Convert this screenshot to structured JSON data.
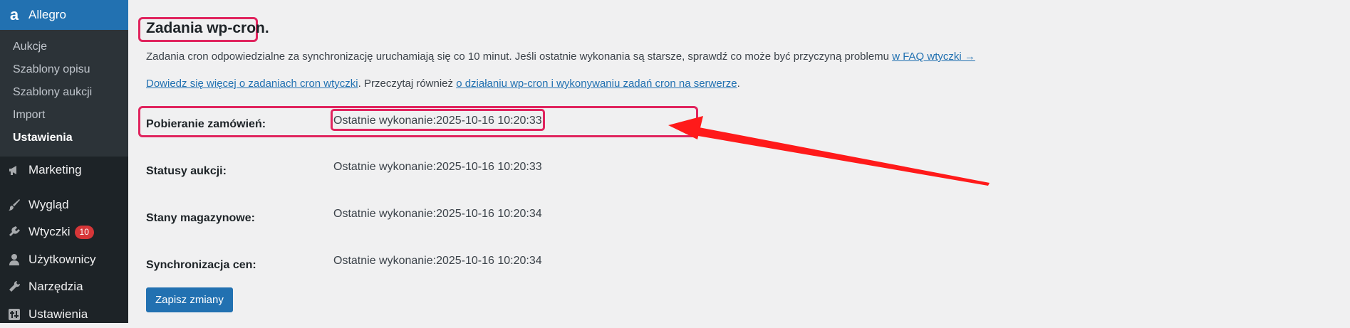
{
  "sidebar": {
    "active": {
      "label": "Allegro",
      "icon": "allegro-logo-icon",
      "glyph": "a"
    },
    "submenu": [
      {
        "label": "Aukcje"
      },
      {
        "label": "Szablony opisu"
      },
      {
        "label": "Szablony aukcji"
      },
      {
        "label": "Import"
      },
      {
        "label": "Ustawienia",
        "current": true
      }
    ],
    "items": [
      {
        "label": "Marketing",
        "icon": "megaphone-icon"
      },
      {
        "label": "Wygląd",
        "icon": "paintbrush-icon"
      },
      {
        "label": "Wtyczki",
        "icon": "plug-icon",
        "badge": "10"
      },
      {
        "label": "Użytkownicy",
        "icon": "user-icon"
      },
      {
        "label": "Narzędzia",
        "icon": "wrench-icon"
      },
      {
        "label": "Ustawienia",
        "icon": "settings-icon"
      }
    ]
  },
  "main": {
    "title": "Zadania wp-cron.",
    "desc1": {
      "text": "Zadania cron odpowiedzialne za synchronizację uruchamiają się co 10 minut. Jeśli ostatnie wykonania są starsze, sprawdź co może być przyczyną problemu ",
      "link": "w FAQ wtyczki →"
    },
    "desc2": {
      "link1": "Dowiedz się więcej o zadaniach cron wtyczki",
      "middle": ". Przeczytaj również ",
      "link2": "o działaniu wp-cron i wykonywaniu zadań cron na serwerze",
      "end": "."
    },
    "rows": [
      {
        "label": "Pobieranie zamówień:",
        "value": "Ostatnie wykonanie:2025-10-16 10:20:33"
      },
      {
        "label": "Statusy aukcji:",
        "value": "Ostatnie wykonanie:2025-10-16 10:20:33"
      },
      {
        "label": "Stany magazynowe:",
        "value": "Ostatnie wykonanie:2025-10-16 10:20:34"
      },
      {
        "label": "Synchronizacja cen:",
        "value": "Ostatnie wykonanie:2025-10-16 10:20:34"
      }
    ],
    "save_label": "Zapisz zmiany"
  },
  "colors": {
    "sidebar_bg": "#1d2327",
    "accent": "#2271b1",
    "highlight": "#e0245e",
    "arrow": "#ff1a1a"
  }
}
